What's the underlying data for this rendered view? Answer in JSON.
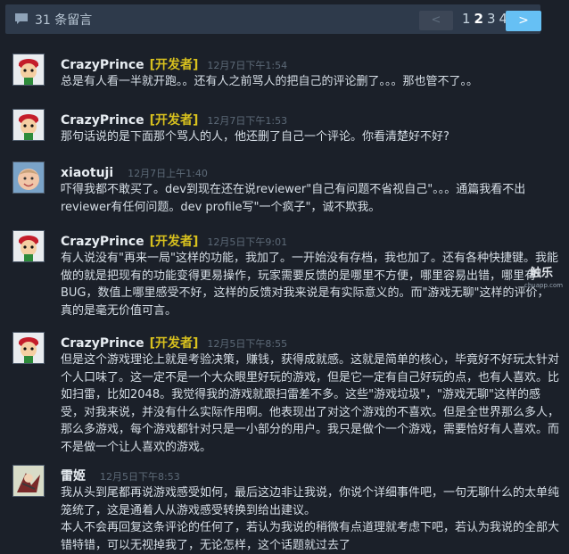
{
  "header": {
    "comment_count": "31 条留言",
    "prev_label": "<",
    "pages": [
      "1",
      "2",
      "3",
      "4"
    ],
    "current_page": "2",
    "next_label": ">"
  },
  "comments": [
    {
      "author": "CrazyPrince",
      "tag": "[开发者]",
      "time": "12月7日下午1:54",
      "body": "总是有人看一半就开跑。。还有人之前骂人的把自己的评论删了。。。那也管不了。。"
    },
    {
      "author": "CrazyPrince",
      "tag": "[开发者]",
      "time": "12月7日下午1:53",
      "body": "那句话说的是下面那个骂人的人，他还删了自己一个评论。你看清楚好不好?"
    },
    {
      "author": "xiaotuji",
      "tag": "",
      "time": "12月7日上午1:40",
      "body": "吓得我都不敢买了。dev到现在还在说reviewer\"自己有问题不省视自己\"。。。通篇我看不出reviewer有任何问题。dev profile写\"一个疯子\"，诚不欺我。"
    },
    {
      "author": "CrazyPrince",
      "tag": "[开发者]",
      "time": "12月5日下午9:01",
      "body": "有人说没有\"再来一局\"这样的功能，我加了。一开始没有存档，我也加了。还有各种快捷键。我能做的就是把现有的功能变得更易操作，玩家需要反馈的是哪里不方便，哪里容易出错，哪里有BUG，数值上哪里感受不好，这样的反馈对我来说是有实际意义的。而\"游戏无聊\"这样的评价，真的是毫无价值可言。"
    },
    {
      "author": "CrazyPrince",
      "tag": "[开发者]",
      "time": "12月5日下午8:55",
      "body": "但是这个游戏理论上就是考验决策，赚钱，获得成就感。这就是简单的核心，毕竟好不好玩太针对个人口味了。这一定不是一个大众眼里好玩的游戏，但是它一定有自己好玩的点，也有人喜欢。比如扫雷，比如2048。我觉得我的游戏就跟扫雷差不多。这些\"游戏垃圾\"，\"游戏无聊\"这样的感受，对我来说，并没有什么实际作用啊。他表现出了对这个游戏的不喜欢。但是全世界那么多人，那么多游戏，每个游戏都针对只是一小部分的用户。我只是做个一个游戏，需要恰好有人喜欢。而不是做一个让人喜欢的游戏。"
    },
    {
      "author": "雷姬",
      "tag": "",
      "time": "12月5日下午8:53",
      "body": "我从头到尾都再说游戏感受如何，最后这边非让我说，你说个详细事件吧，一句无聊什么的太单纯笼统了，这是通着人从游戏感受转换到给出建议。\n本人不会再回复这条评论的任何了，若认为我说的稍微有点道理就考虑下吧，若认为我说的全部大错特错，可以无视掉我了，无论怎样，这个话题就过去了"
    }
  ],
  "watermark": {
    "text": "触乐",
    "sub": "chuapp.com"
  }
}
